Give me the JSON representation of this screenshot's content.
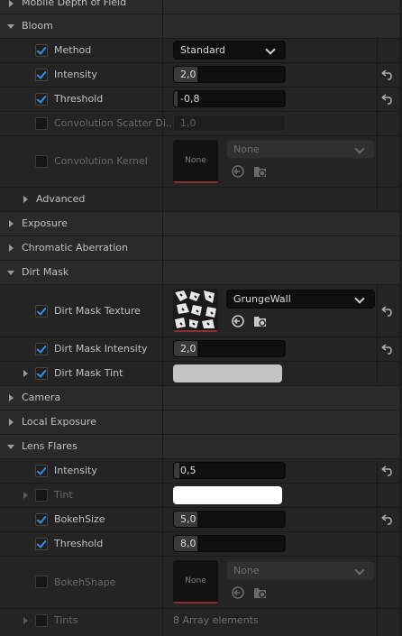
{
  "top_partial": "Mobile Depth of Field",
  "bloom": {
    "title": "Bloom",
    "method_label": "Method",
    "method_value": "Standard",
    "intensity_label": "Intensity",
    "intensity_value": "2,0",
    "threshold_label": "Threshold",
    "threshold_value": "-0,8",
    "conv_scatter_label": "Convolution Scatter Di...",
    "conv_scatter_value": "1,0",
    "conv_kernel_label": "Convolution Kernel",
    "conv_kernel_thumb": "None",
    "conv_kernel_value": "None",
    "advanced_label": "Advanced"
  },
  "exposure": "Exposure",
  "chromatic": "Chromatic Aberration",
  "dirt": {
    "title": "Dirt Mask",
    "texture_label": "Dirt Mask Texture",
    "texture_value": "GrungeWall",
    "intensity_label": "Dirt Mask Intensity",
    "intensity_value": "2,0",
    "tint_label": "Dirt Mask Tint"
  },
  "camera": "Camera",
  "local_exposure": "Local Exposure",
  "lens": {
    "title": "Lens Flares",
    "intensity_label": "Intensity",
    "intensity_value": "0,5",
    "tint_label": "Tint",
    "bokehsize_label": "BokehSize",
    "bokehsize_value": "5,0",
    "threshold_label": "Threshold",
    "threshold_value": "8,0",
    "bokehshape_label": "BokehShape",
    "bokehshape_thumb": "None",
    "bokehshape_value": "None",
    "tints_label": "Tints",
    "tints_value": "8 Array elements"
  },
  "colors": {
    "accent": "#2f8fe6",
    "panel": "#242424",
    "category": "#2a2a2a",
    "dirt_tint": "#c4c4c4",
    "lens_tint": "#ffffff"
  },
  "icons": [
    "expand-arrow-icon",
    "collapse-arrow-icon",
    "checkbox-icon",
    "chevron-down-icon",
    "reset-arrow-icon",
    "use-selected-asset-icon",
    "browse-asset-icon"
  ]
}
